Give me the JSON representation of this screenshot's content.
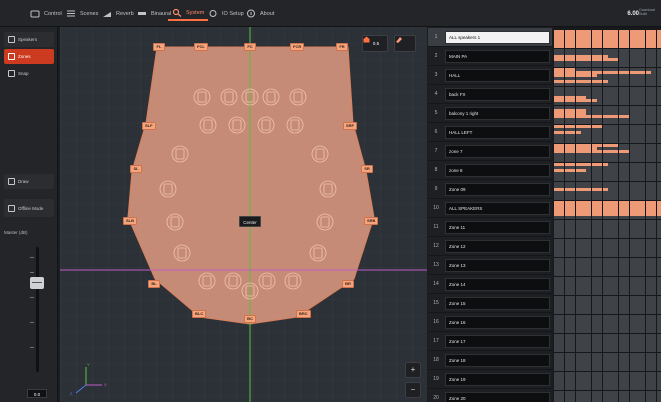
{
  "tabs": [
    {
      "label": "Control",
      "icon": "control-icon"
    },
    {
      "label": "Scenes",
      "icon": "scenes-icon"
    },
    {
      "label": "Reverb",
      "icon": "reverb-icon"
    },
    {
      "label": "Binaural",
      "icon": "binaural-icon"
    },
    {
      "label": "System",
      "icon": "system-icon",
      "active": true
    },
    {
      "label": "IO Setup",
      "icon": "io-setup-icon"
    },
    {
      "label": "About",
      "icon": "about-icon"
    }
  ],
  "version": {
    "value": "6.00",
    "caption": "Download Build"
  },
  "sidebar": {
    "buttons": [
      {
        "label": "Speakers",
        "icon": "speakers-icon"
      },
      {
        "label": "Zones",
        "icon": "zones-icon",
        "active": true
      },
      {
        "label": "Snap",
        "icon": "snap-icon"
      },
      {
        "label": "Draw",
        "icon": "draw-icon"
      },
      {
        "label": "Offline Mode",
        "icon": "offline-icon"
      }
    ],
    "fader_label": "Master (dB)",
    "fader_value": "0.0"
  },
  "canvas": {
    "center_label": "Center",
    "top_buttons": [
      {
        "label": "0.5",
        "icon": "home-icon"
      },
      {
        "label": "",
        "icon": "eraser-icon"
      }
    ],
    "zoom_in": "+",
    "zoom_out": "−",
    "axis_labels": {
      "x": "X",
      "y": "Y",
      "z": "Z"
    },
    "speaker_labels": [
      "FL",
      "FCL",
      "FC",
      "FCR",
      "FR",
      "SLF",
      "SRF",
      "SL",
      "SR",
      "SLB",
      "SRB",
      "BL",
      "BR",
      "BLC",
      "BC",
      "BRC"
    ]
  },
  "zones": [
    {
      "num": "1",
      "name": "ALL speakers 1"
    },
    {
      "num": "2",
      "name": "MAIN PA"
    },
    {
      "num": "3",
      "name": "HALL"
    },
    {
      "num": "4",
      "name": "back FX"
    },
    {
      "num": "5",
      "name": "balcony 1 right"
    },
    {
      "num": "6",
      "name": "HALL LEFT"
    },
    {
      "num": "7",
      "name": "zone 7"
    },
    {
      "num": "8",
      "name": "zone 8"
    },
    {
      "num": "9",
      "name": "Zone 09"
    },
    {
      "num": "10",
      "name": "ALL SPEAKERS"
    },
    {
      "num": "11",
      "name": "Zone 11"
    },
    {
      "num": "12",
      "name": "Zone 12"
    },
    {
      "num": "13",
      "name": "Zone 13"
    },
    {
      "num": "14",
      "name": "Zone 14"
    },
    {
      "num": "15",
      "name": "Zone 15"
    },
    {
      "num": "16",
      "name": "Zone 16"
    },
    {
      "num": "17",
      "name": "Zone 17"
    },
    {
      "num": "18",
      "name": "Zone 18"
    },
    {
      "num": "19",
      "name": "Zone 19"
    },
    {
      "num": "20",
      "name": "Zone 20"
    }
  ],
  "colors": {
    "accent": "#ff7043",
    "zone_fill": "#e8a084",
    "matrix_on": "#ef9a76"
  }
}
